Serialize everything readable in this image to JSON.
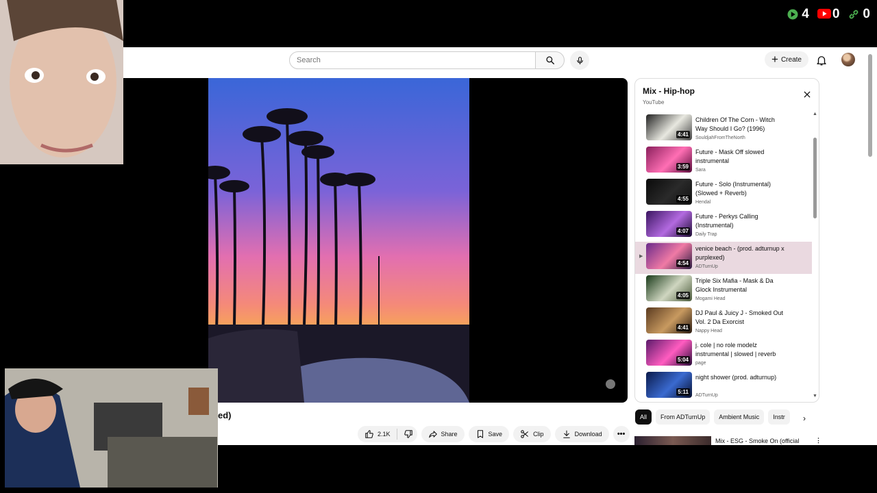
{
  "counters": [
    {
      "icon": "play-icon",
      "color": "#4caf50",
      "value": "4"
    },
    {
      "icon": "youtube-icon",
      "color": "#ff0000",
      "value": "0"
    },
    {
      "icon": "link-icon",
      "color": "#4caf50",
      "value": "0"
    }
  ],
  "masthead": {
    "search_placeholder": "Search",
    "create_label": "Create"
  },
  "video": {
    "title_fragment": "ed)"
  },
  "actions": {
    "likes": "2.1K",
    "share": "Share",
    "save": "Save",
    "clip": "Clip",
    "download": "Download"
  },
  "playlist": {
    "title": "Mix - Hip-hop",
    "channel": "YouTube",
    "items": [
      {
        "title": "Children Of The Corn - Witch Way Should I Go? (1996)",
        "channel": "SouldjahFromTheNorth",
        "duration": "4:41",
        "thumb": [
          "#222",
          "#e8e8e0",
          "#444"
        ]
      },
      {
        "title": "Future - Mask Off slowed instrumental",
        "channel": "Sara",
        "duration": "3:59",
        "thumb": [
          "#8a1f5c",
          "#ff6fb4",
          "#5a0a3a"
        ]
      },
      {
        "title": "Future - Solo (Instrumental) (Slowed + Reverb)",
        "channel": "Hendal",
        "duration": "4:55",
        "thumb": [
          "#0a0a0a",
          "#2a2a2a",
          "#111"
        ]
      },
      {
        "title": "Future - Perkys Calling (Instrumental)",
        "channel": "Daily Trap",
        "duration": "4:07",
        "thumb": [
          "#3a1560",
          "#b36ae0",
          "#1c0a33"
        ]
      },
      {
        "title": "venice beach - (prod. adturnup x purplexed)",
        "channel": "ADTurnUp",
        "duration": "4:54",
        "thumb": [
          "#6a2a8a",
          "#f07aa5",
          "#2a1a40"
        ],
        "active": true
      },
      {
        "title": "Triple Six Mafia - Mask & Da Glock Instrumental",
        "channel": "Mogami Head",
        "duration": "4:05",
        "thumb": [
          "#1a3a1a",
          "#cfd6c0",
          "#4a5a3a"
        ]
      },
      {
        "title": "DJ Paul & Juicy J - Smoked Out Vol. 2 Da Exorcist",
        "channel": "Nappy Head",
        "duration": "4:41",
        "thumb": [
          "#5a3a20",
          "#c89a60",
          "#2a1a10"
        ]
      },
      {
        "title": "j. cole | no role modelz instrumental | slowed | reverb",
        "channel": "page",
        "duration": "5:04",
        "thumb": [
          "#5a1a6a",
          "#ff5cc0",
          "#2a0a3a"
        ]
      },
      {
        "title": "night shower (prod. adturnup)",
        "channel": "ADTurnUp",
        "duration": "5:11",
        "thumb": [
          "#0a1a4a",
          "#3a6ad0",
          "#061030"
        ]
      }
    ]
  },
  "chips": [
    "All",
    "From ADTurnUp",
    "Ambient Music",
    "Instr"
  ],
  "recommendation": {
    "title": "Mix - ESG - Smoke On (official"
  }
}
